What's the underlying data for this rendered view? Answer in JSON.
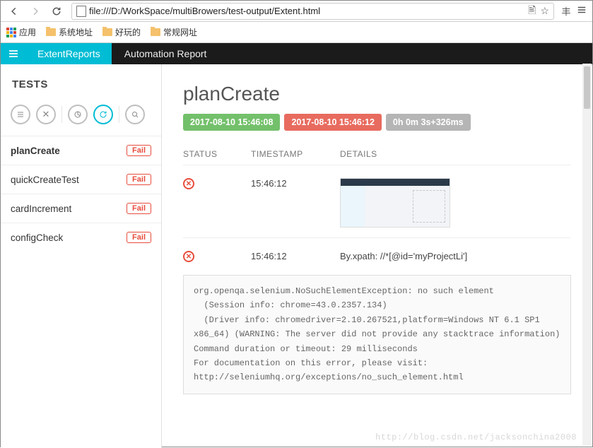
{
  "browser": {
    "url": "file:///D:/WorkSpace/multiBrowers/test-output/Extent.html",
    "apps_label": "应用",
    "bookmarks": [
      "系统地址",
      "好玩的",
      "常规网址"
    ]
  },
  "header": {
    "brand": "ExtentReports",
    "title": "Automation Report"
  },
  "sidebar": {
    "title": "TESTS",
    "tests": [
      {
        "name": "planCreate",
        "status": "Fail"
      },
      {
        "name": "quickCreateTest",
        "status": "Fail"
      },
      {
        "name": "cardIncrement",
        "status": "Fail"
      },
      {
        "name": "configCheck",
        "status": "Fail"
      }
    ]
  },
  "detail": {
    "title": "planCreate",
    "start_chip": "2017-08-10 15:46:08",
    "end_chip": "2017-08-10 15:46:12",
    "duration_chip": "0h 0m 3s+326ms",
    "columns": {
      "status": "STATUS",
      "timestamp": "TIMESTAMP",
      "details": "DETAILS"
    },
    "steps": [
      {
        "time": "15:46:12",
        "kind": "screenshot"
      },
      {
        "time": "15:46:12",
        "kind": "text",
        "text": "By.xpath: //*[@id='myProjectLi']"
      }
    ],
    "stack": "org.openqa.selenium.NoSuchElementException: no such element\n  (Session info: chrome=43.0.2357.134)\n  (Driver info: chromedriver=2.10.267521,platform=Windows NT 6.1 SP1 x86_64) (WARNING: The server did not provide any stacktrace information)\nCommand duration or timeout: 29 milliseconds\nFor documentation on this error, please visit: http://seleniumhq.org/exceptions/no_such_element.html"
  },
  "watermark": "http://blog.csdn.net/jacksonchina2008"
}
